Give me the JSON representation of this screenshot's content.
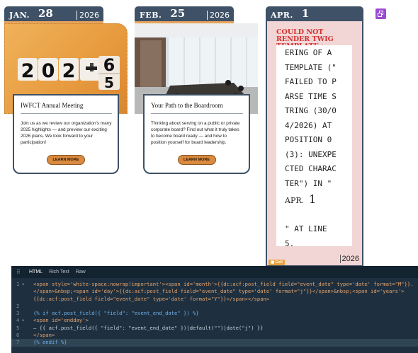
{
  "events": [
    {
      "month": "JAN.",
      "day": "28",
      "year": "2026",
      "image_text": [
        "2",
        "0",
        "2",
        "6",
        "5"
      ],
      "title": "IWFCT Annual Meeting",
      "description": "Join us as we review our organization's many 2025 highlights — and preview our exciting 2026 plans. We look forward to your participation!",
      "button": "LEARN MORE"
    },
    {
      "month": "FEB.",
      "day": "25",
      "year": "2026",
      "title": "Your Path to the Boardroom",
      "description": "Thinking about serving on a public or private corporate board? Find out what it truly takes to become board ready — and how to position yourself for board leadership.",
      "button": "LEARN MORE"
    }
  ],
  "error_card": {
    "month": "APR.",
    "day": "1",
    "error_title": "COULD NOT RENDER TWIG TEMPLATE :",
    "error_lines": [
      "ERING OF A",
      "TEMPLATE (\"",
      "FAILED TO P",
      "ARSE TIME S",
      "TRING (30/0",
      "4/2026) AT",
      "POSITION 0",
      "(3): UNEXPE",
      "CTED CHARAC",
      "TER\") IN \""
    ],
    "inline_month": "APR.",
    "inline_day": "1",
    "error_tail": [
      "\" AT LINE",
      "5."
    ],
    "year": "2026",
    "cell_tag": "Cell"
  },
  "editor": {
    "tabs": [
      "HTML",
      "Rich Text",
      "Raw"
    ],
    "active_tab": "HTML",
    "lines": [
      {
        "n": "1",
        "fold": "▾",
        "text": "<span style='white-space:nowrap!important'><span id='month'>{{dc:acf:post_field field=\"event_date\" type='date' format=\"M\"}}."
      },
      {
        "n": "",
        "fold": "",
        "text": "</span>&nbsp;<span id='day'>{{dc:acf:post_field field=\"event_date\" type='date' format=\"j\"}}</span>&nbsp;<span id='years'>"
      },
      {
        "n": "",
        "fold": "",
        "text": "{{dc:acf:post_field field=\"event_date\" type='date' format=\"Y\"}}</span></span>"
      },
      {
        "n": "2",
        "fold": "",
        "text": ""
      },
      {
        "n": "3",
        "fold": "",
        "text": "{% if acf.post_field({ \"field\": \"event_end_date\" }) %}"
      },
      {
        "n": "4",
        "fold": "▾",
        "text": "<span id='endday'>"
      },
      {
        "n": "5",
        "fold": "",
        "text": "– {{ acf.post_field({ \"field\": \"event_end_date\" })|default(\"\")|date(\"j\") }}"
      },
      {
        "n": "6",
        "fold": "",
        "text": "</span>"
      },
      {
        "n": "7",
        "fold": "",
        "text": "{% endif %}"
      }
    ]
  }
}
